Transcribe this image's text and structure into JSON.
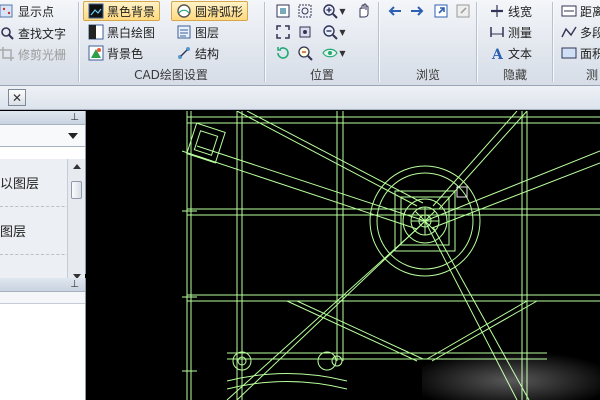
{
  "ribbon": {
    "col1": {
      "show_points": "显示点",
      "find_text": "查找文字",
      "crop_raster": "修剪光栅"
    },
    "cad_settings": {
      "label": "CAD绘图设置",
      "black_bg": "黑色背景",
      "smooth_arc": "圆滑弧形",
      "bw_drawing": "黑白绘图",
      "layers": "图层",
      "bg_color": "背景色",
      "structure": "结构"
    },
    "position": {
      "label": "位置"
    },
    "browse": {
      "label": "浏览"
    },
    "hide": {
      "label": "隐藏",
      "line_width": "线宽",
      "measure": "测量",
      "text": "文本"
    },
    "right": {
      "distance": "距离",
      "multi": "多段",
      "area": "面积",
      "partial_label": "测"
    }
  },
  "left_panel": {
    "layer_items": [
      "以图层",
      "图层"
    ]
  },
  "colors": {
    "cad_line": "#b8ff9c",
    "canvas_bg": "#000000",
    "active_btn": "#ffd980"
  }
}
